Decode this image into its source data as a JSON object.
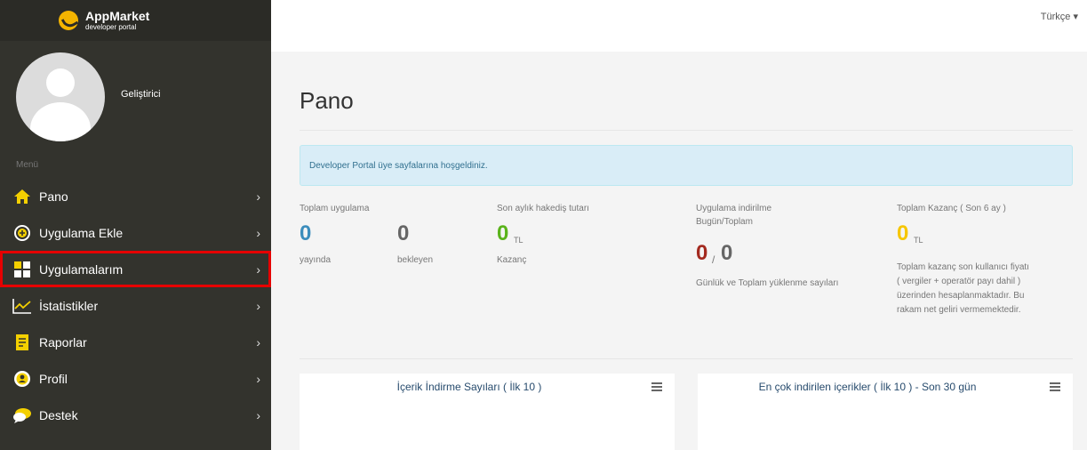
{
  "brand": {
    "title": "AppMarket",
    "subtitle": "developer portal"
  },
  "profile": {
    "name": "Geliştirici"
  },
  "menu": {
    "label": "Menü",
    "items": [
      {
        "label": "Pano",
        "icon": "home-icon",
        "chevron": "›"
      },
      {
        "label": "Uygulama Ekle",
        "icon": "plus-circle-icon",
        "chevron": "›"
      },
      {
        "label": "Uygulamalarım",
        "icon": "grid-icon",
        "chevron": "›"
      },
      {
        "label": "İstatistikler",
        "icon": "line-chart-icon",
        "chevron": "›"
      },
      {
        "label": "Raporlar",
        "icon": "document-icon",
        "chevron": "›"
      },
      {
        "label": "Profil",
        "icon": "user-icon",
        "chevron": "›"
      },
      {
        "label": "Destek",
        "icon": "chat-icon",
        "chevron": "›"
      }
    ]
  },
  "topbar": {
    "language": "Türkçe ▾"
  },
  "page": {
    "title": "Pano",
    "alert": "Developer Portal üye sayfalarına hoşgeldiniz."
  },
  "stats": {
    "total_apps": {
      "label": "Toplam uygulama",
      "live_value": "0",
      "live_label": "yayında",
      "pending_value": "0",
      "pending_label": "bekleyen"
    },
    "monthly_earnings": {
      "label": "Son aylık hakediş tutarı",
      "value": "0",
      "unit": "TL",
      "sub": "Kazanç"
    },
    "downloads": {
      "label_line1": "Uygulama indirilme",
      "label_line2": "Bugün/Toplam",
      "today": "0",
      "separator": "/",
      "total": "0",
      "sub": "Günlük ve Toplam yüklenme sayıları"
    },
    "total_revenue": {
      "label": "Toplam Kazanç ( Son 6 ay )",
      "value": "0",
      "unit": "TL",
      "note_lines": [
        "Toplam kazanç son kullanıcı fiyatı",
        "( vergiler + operatör payı dahil )",
        "üzerinden hesaplanmaktadır. Bu",
        "rakam net geliri vermemektedir."
      ]
    }
  },
  "panels": [
    {
      "title": "İçerik İndirme Sayıları ( İlk 10 )"
    },
    {
      "title": "En çok indirilen içerikler ( İlk 10 ) - Son 30 gün"
    }
  ],
  "colors": {
    "sidebar": "#33332d",
    "highlight": "#e60000",
    "blue": "#3c8dbc",
    "green": "#5ab31b",
    "red": "#a32a1f",
    "yellow": "#f6c600"
  }
}
